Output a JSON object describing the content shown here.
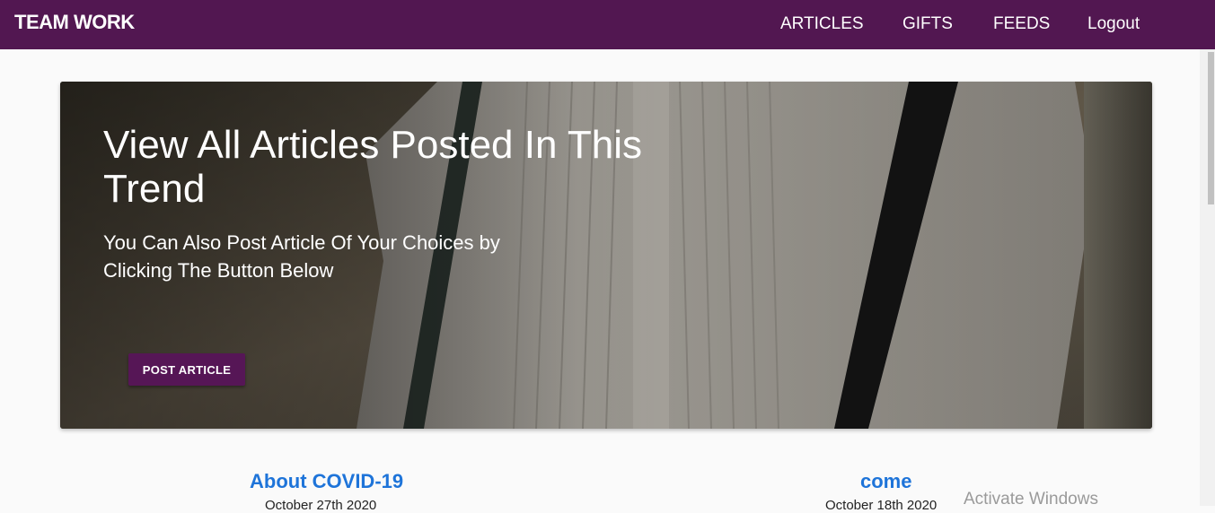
{
  "navbar": {
    "brand": "TEAM WORK",
    "links": [
      "ARTICLES",
      "GIFTS",
      "FEEDS",
      "Logout"
    ],
    "background": "#521751"
  },
  "hero": {
    "title": "View All Articles Posted In This Trend",
    "subtitle": "You Can Also Post Article Of Your Choices by Clicking The Button Below",
    "button_label": "POST ARTICLE",
    "button_color": "#561656"
  },
  "articles": [
    {
      "title": "About COVID-19",
      "date": "October 27th 2020"
    },
    {
      "title": "come",
      "date": "October 18th 2020"
    }
  ],
  "overlay": {
    "watermark": "Activate Windows"
  },
  "colors": {
    "link": "#1e74d9"
  }
}
